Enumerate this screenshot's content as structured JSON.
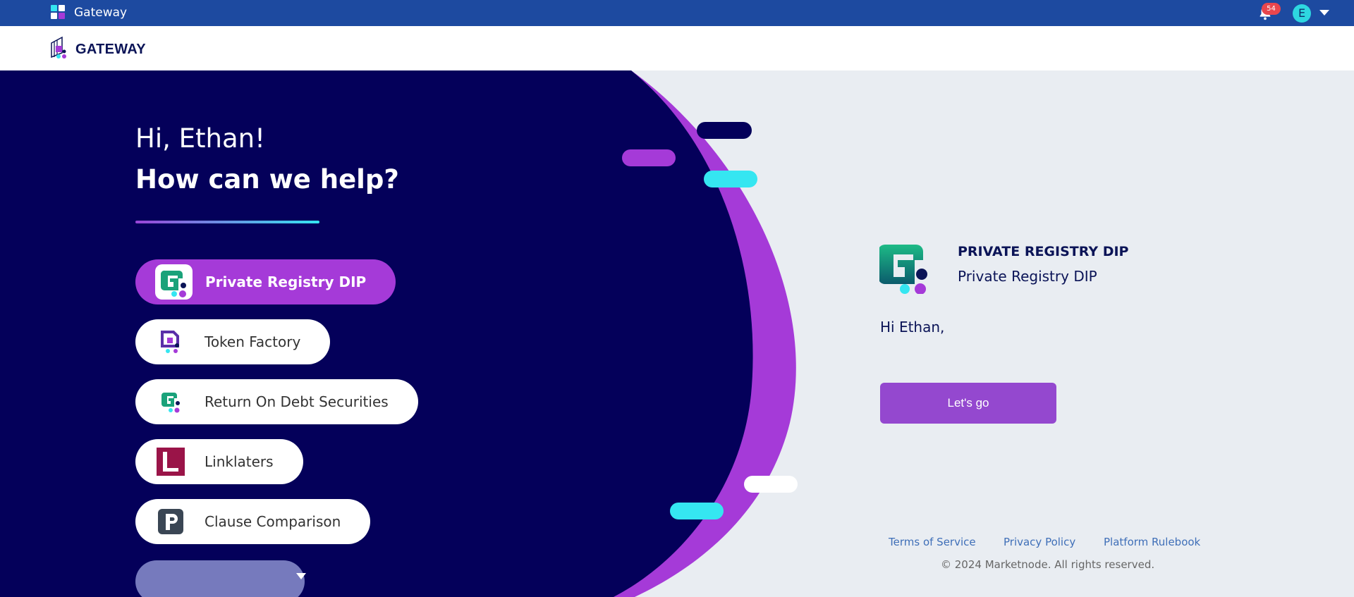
{
  "topbar": {
    "title": "Gateway",
    "notification_count": "54",
    "user_initial": "E"
  },
  "header": {
    "brand": "GATEWAY"
  },
  "hero": {
    "greeting": "Hi, Ethan!",
    "headline": "How can we help?"
  },
  "apps": [
    {
      "label": "Private Registry DIP",
      "icon": "private-registry-icon",
      "active": true
    },
    {
      "label": "Token Factory",
      "icon": "token-factory-icon",
      "active": false
    },
    {
      "label": "Return On Debt Securities",
      "icon": "return-on-debt-icon",
      "active": false
    },
    {
      "label": "Linklaters",
      "icon": "linklaters-icon",
      "active": false
    },
    {
      "label": "Clause Comparison",
      "icon": "clause-comparison-icon",
      "active": false
    }
  ],
  "detail": {
    "title": "PRIVATE REGISTRY DIP",
    "subtitle": "Private Registry DIP",
    "greeting": "Hi Ethan,",
    "button": "Let's go"
  },
  "footer": {
    "links": [
      "Terms of Service",
      "Privacy Policy",
      "Platform Rulebook"
    ],
    "copyright": "© 2024 Marketnode. All rights reserved."
  },
  "colors": {
    "topbar": "#1d4aa0",
    "hero_navy": "#04005a",
    "accent_purple": "#a53ad8",
    "accent_cyan": "#35e6f1",
    "button": "#9448cf"
  }
}
